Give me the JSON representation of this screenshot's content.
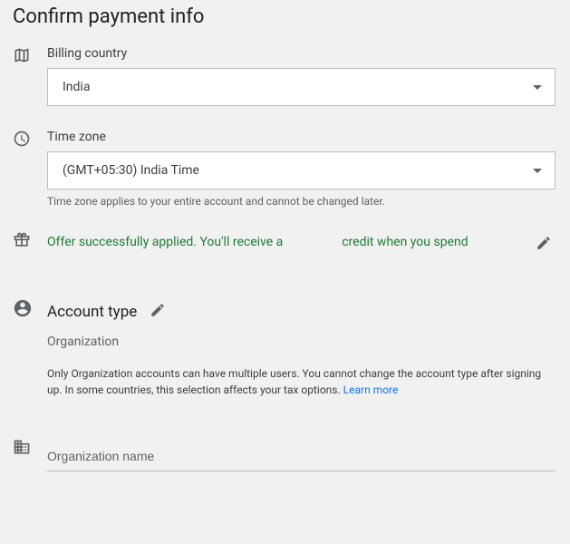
{
  "heading": "Confirm payment info",
  "billing": {
    "label": "Billing country",
    "value": "India"
  },
  "timezone": {
    "label": "Time zone",
    "value": "(GMT+05:30) India Time",
    "helper": "Time zone applies to your entire account and cannot be changed later."
  },
  "offer": {
    "text_before": "Offer successfully applied. You'll receive a",
    "text_after": "credit when you spend"
  },
  "account": {
    "title": "Account type",
    "value": "Organization",
    "description_before": "Only Organization accounts can have multiple users. You cannot change the account type after signing up. In some countries, this selection affects your tax options. ",
    "learn_more": "Learn more"
  },
  "organization": {
    "placeholder": "Organization name"
  }
}
